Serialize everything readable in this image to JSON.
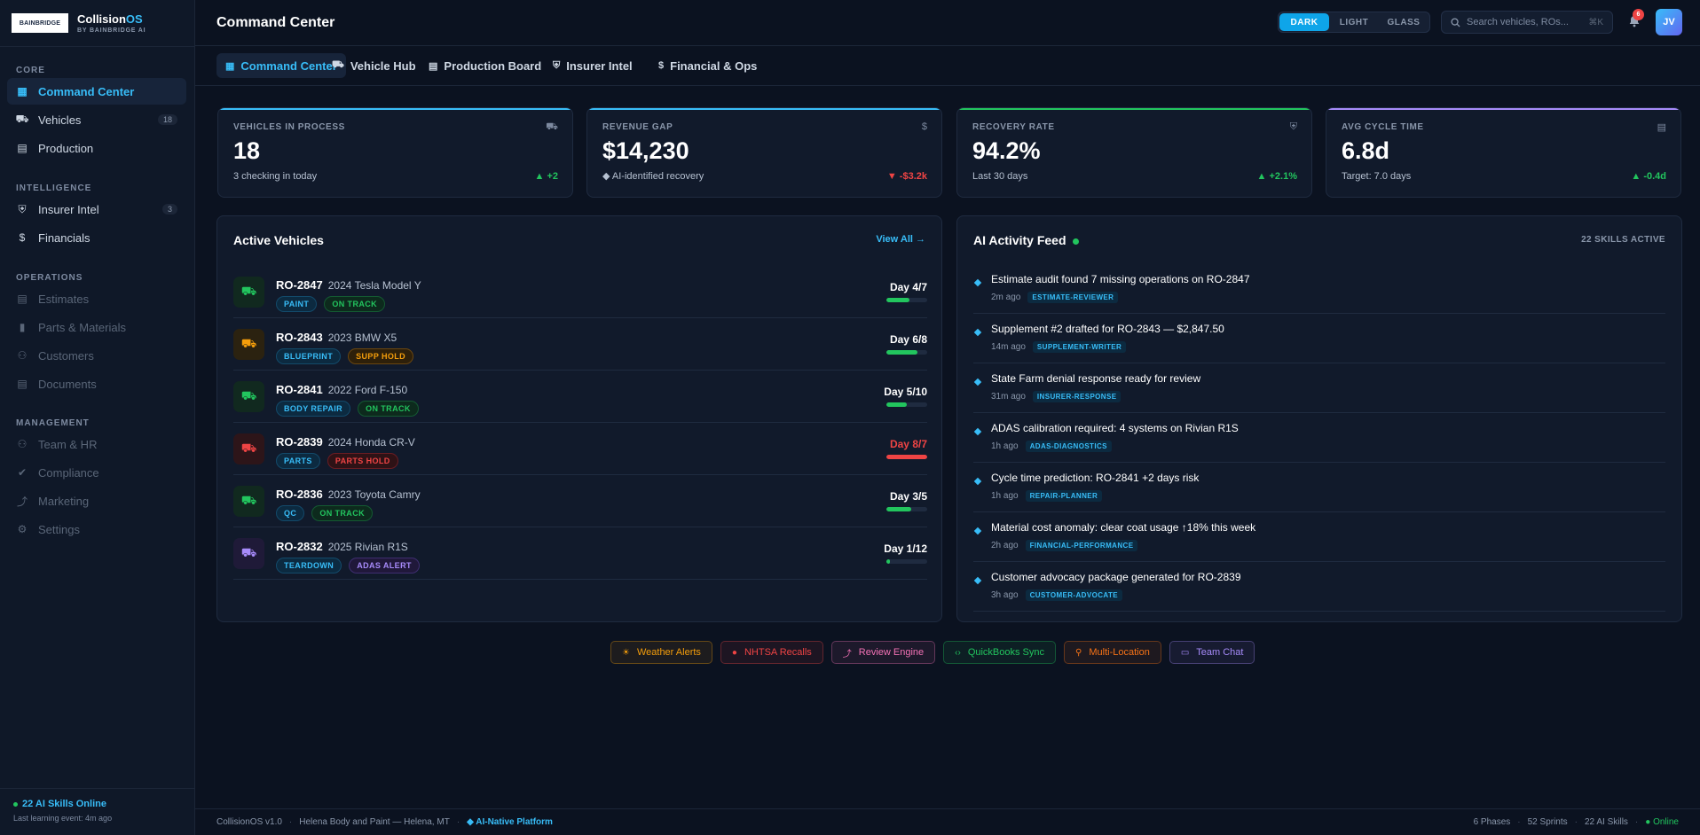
{
  "brand": {
    "logo_text": "BAINBRIDGE",
    "name_a": "Collision",
    "name_b": "OS",
    "sub": "BY BAINBRIDGE AI"
  },
  "sidebar": {
    "sections": [
      {
        "label": "CORE",
        "items": [
          {
            "label": "Command Center",
            "icon": "grid-icon",
            "active": true
          },
          {
            "label": "Vehicles",
            "icon": "car-icon",
            "count": "18"
          },
          {
            "label": "Production",
            "icon": "list-icon"
          }
        ]
      },
      {
        "label": "INTELLIGENCE",
        "items": [
          {
            "label": "Insurer Intel",
            "icon": "shield-icon",
            "count": "3"
          },
          {
            "label": "Financials",
            "icon": "dollar-icon"
          }
        ]
      },
      {
        "label": "OPERATIONS",
        "items": [
          {
            "label": "Estimates",
            "icon": "document-icon"
          },
          {
            "label": "Parts & Materials",
            "icon": "bookmark-icon"
          },
          {
            "label": "Customers",
            "icon": "users-icon"
          },
          {
            "label": "Documents",
            "icon": "document-icon"
          }
        ]
      },
      {
        "label": "MANAGEMENT",
        "items": [
          {
            "label": "Team & HR",
            "icon": "users-icon"
          },
          {
            "label": "Compliance",
            "icon": "check-icon"
          },
          {
            "label": "Marketing",
            "icon": "trend-icon"
          },
          {
            "label": "Settings",
            "icon": "gear-icon"
          }
        ]
      }
    ],
    "online": "22 AI Skills Online",
    "learning": "Last learning event: 4m ago"
  },
  "header": {
    "title": "Command Center",
    "themes": [
      "DARK",
      "LIGHT",
      "GLASS"
    ],
    "active_theme": "DARK",
    "search_placeholder": "Search vehicles, ROs...",
    "search_kbd": "⌘K",
    "notif_count": "6",
    "avatar": "JV"
  },
  "tabs": [
    {
      "label": "Command Center",
      "icon": "grid-icon",
      "active": true
    },
    {
      "label": "Vehicle Hub",
      "icon": "car-icon"
    },
    {
      "label": "Production Board",
      "icon": "list-icon"
    },
    {
      "label": "Insurer Intel",
      "icon": "shield-icon"
    },
    {
      "label": "Financial & Ops",
      "icon": "dollar-icon"
    }
  ],
  "kpis": [
    {
      "label": "VEHICLES IN PROCESS",
      "value": "18",
      "sub": "3 checking in today",
      "delta": "▲ +2",
      "trend": "up",
      "icon": "car-icon",
      "color": "#38bdf8"
    },
    {
      "label": "REVENUE GAP",
      "value": "$14,230",
      "sub": "◆ AI-identified recovery",
      "delta": "▼ -$3.2k",
      "trend": "down",
      "icon": "dollar-icon",
      "color": "#38bdf8"
    },
    {
      "label": "RECOVERY RATE",
      "value": "94.2%",
      "sub": "Last 30 days",
      "delta": "▲ +2.1%",
      "trend": "up",
      "icon": "shield-icon",
      "color": "#22c55e"
    },
    {
      "label": "AVG CYCLE TIME",
      "value": "6.8d",
      "sub": "Target: 7.0 days",
      "delta": "▲ -0.4d",
      "trend": "up",
      "icon": "document-icon",
      "color": "#a78bfa"
    }
  ],
  "vehicles": {
    "title": "Active Vehicles",
    "view_all": "View All →",
    "rows": [
      {
        "ro": "RO-2847",
        "model": "2024 Tesla Model Y",
        "tags": [
          {
            "text": "PAINT",
            "style": "blue"
          },
          {
            "text": "ON TRACK",
            "style": "green"
          }
        ],
        "day": "Day 4/7",
        "progress": 0.57,
        "color": "#22c55e",
        "icon_bg": "#11291f",
        "day_color": "#ffffff"
      },
      {
        "ro": "RO-2843",
        "model": "2023 BMW X5",
        "tags": [
          {
            "text": "BLUEPRINT",
            "style": "blue"
          },
          {
            "text": "SUPP HOLD",
            "style": "orange"
          }
        ],
        "day": "Day 6/8",
        "progress": 0.75,
        "color": "#f59e0b",
        "icon_bg": "#2b2210",
        "day_color": "#ffffff",
        "bar_color": "#22c55e"
      },
      {
        "ro": "RO-2841",
        "model": "2022 Ford F-150",
        "tags": [
          {
            "text": "BODY REPAIR",
            "style": "blue"
          },
          {
            "text": "ON TRACK",
            "style": "green"
          }
        ],
        "day": "Day 5/10",
        "progress": 0.5,
        "color": "#22c55e",
        "icon_bg": "#11291f",
        "day_color": "#ffffff"
      },
      {
        "ro": "RO-2839",
        "model": "2024 Honda CR-V",
        "tags": [
          {
            "text": "PARTS",
            "style": "blue"
          },
          {
            "text": "PARTS HOLD",
            "style": "red"
          }
        ],
        "day": "Day 8/7",
        "progress": 1.0,
        "color": "#ef4444",
        "icon_bg": "#2d1519",
        "day_color": "#ef4444"
      },
      {
        "ro": "RO-2836",
        "model": "2023 Toyota Camry",
        "tags": [
          {
            "text": "QC",
            "style": "blue"
          },
          {
            "text": "ON TRACK",
            "style": "green"
          }
        ],
        "day": "Day 3/5",
        "progress": 0.6,
        "color": "#22c55e",
        "icon_bg": "#11291f",
        "day_color": "#ffffff"
      },
      {
        "ro": "RO-2832",
        "model": "2025 Rivian R1S",
        "tags": [
          {
            "text": "TEARDOWN",
            "style": "blue"
          },
          {
            "text": "ADAS ALERT",
            "style": "purple"
          }
        ],
        "day": "Day 1/12",
        "progress": 0.08,
        "color": "#a78bfa",
        "icon_bg": "#1f1a38",
        "day_color": "#ffffff",
        "bar_color": "#22c55e"
      }
    ]
  },
  "feed": {
    "title": "AI Activity Feed",
    "skills": "22 SKILLS ACTIVE",
    "rows": [
      {
        "text": "Estimate audit found 7 missing operations on RO-2847",
        "time": "2m ago",
        "tag": "ESTIMATE-REVIEWER"
      },
      {
        "text": "Supplement #2 drafted for RO-2843 — $2,847.50",
        "time": "14m ago",
        "tag": "SUPPLEMENT-WRITER"
      },
      {
        "text": "State Farm denial response ready for review",
        "time": "31m ago",
        "tag": "INSURER-RESPONSE"
      },
      {
        "text": "ADAS calibration required: 4 systems on Rivian R1S",
        "time": "1h ago",
        "tag": "ADAS-DIAGNOSTICS"
      },
      {
        "text": "Cycle time prediction: RO-2841 +2 days risk",
        "time": "1h ago",
        "tag": "REPAIR-PLANNER"
      },
      {
        "text": "Material cost anomaly: clear coat usage ↑18% this week",
        "time": "2h ago",
        "tag": "FINANCIAL-PERFORMANCE"
      },
      {
        "text": "Customer advocacy package generated for RO-2839",
        "time": "3h ago",
        "tag": "CUSTOMER-ADVOCATE"
      }
    ]
  },
  "integrations": [
    {
      "label": "Weather Alerts",
      "icon": "sun-icon",
      "color": "#f59e0b"
    },
    {
      "label": "NHTSA Recalls",
      "icon": "alert-icon",
      "color": "#ef4444"
    },
    {
      "label": "Review Engine",
      "icon": "trend-icon",
      "color": "#f472b6"
    },
    {
      "label": "QuickBooks Sync",
      "icon": "code-icon",
      "color": "#22c55e"
    },
    {
      "label": "Multi-Location",
      "icon": "pin-icon",
      "color": "#f97316"
    },
    {
      "label": "Team Chat",
      "icon": "chat-icon",
      "color": "#a78bfa"
    }
  ],
  "footer": {
    "version": "CollisionOS v1.0",
    "shop": "Helena Body and Paint — Helena, MT",
    "platform": "◆ AI-Native Platform",
    "phases": "6 Phases",
    "sprints": "52 Sprints",
    "skills": "22 AI Skills",
    "online": "● Online"
  }
}
